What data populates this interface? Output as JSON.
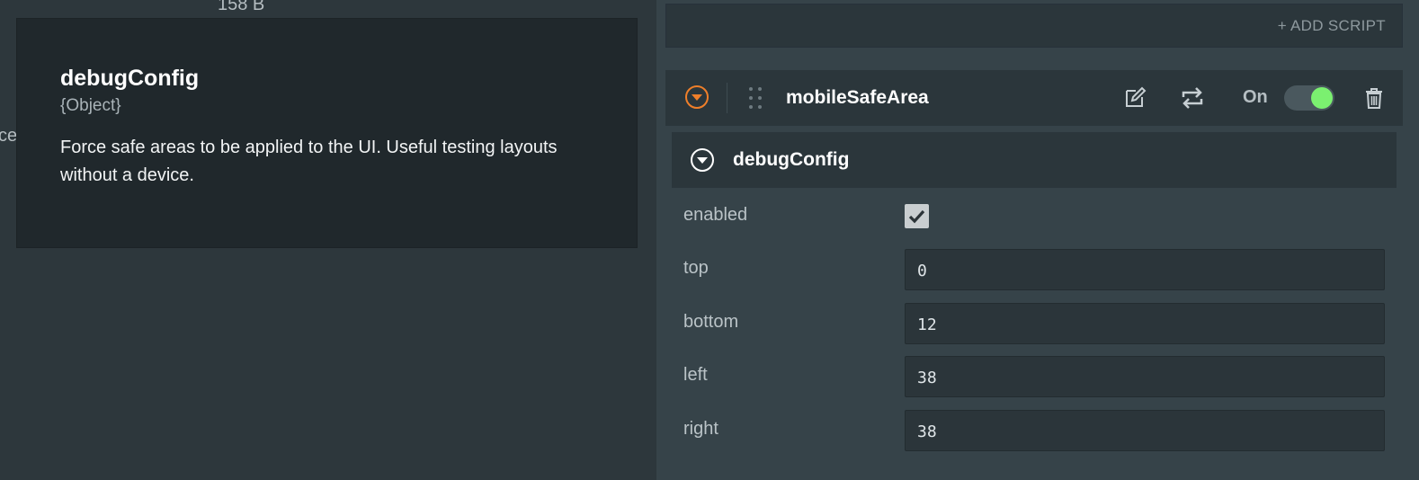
{
  "left": {
    "size_label": "158 B",
    "edge_text": "ce"
  },
  "tooltip": {
    "title": "debugConfig",
    "type": "{Object}",
    "description": "Force safe areas to be applied to the UI. Useful testing layouts without a device."
  },
  "toolbar": {
    "add_script_label": "+ ADD SCRIPT"
  },
  "script": {
    "name": "mobileSafeArea",
    "toggle_label": "On",
    "enabled": true,
    "icons": {
      "collapse": "chevron-down-circle-icon",
      "drag": "drag-handle-icon",
      "edit": "edit-icon",
      "swap": "swap-icon",
      "delete": "trash-icon"
    },
    "accent_color": "#ef7f2a",
    "toggle_color": "#7bf070"
  },
  "section": {
    "title": "debugConfig",
    "fields": {
      "enabled": {
        "label": "enabled",
        "checked": true
      },
      "top": {
        "label": "top",
        "value": "0"
      },
      "bottom": {
        "label": "bottom",
        "value": "12"
      },
      "left": {
        "label": "left",
        "value": "38"
      },
      "right": {
        "label": "right",
        "value": "38"
      }
    }
  }
}
